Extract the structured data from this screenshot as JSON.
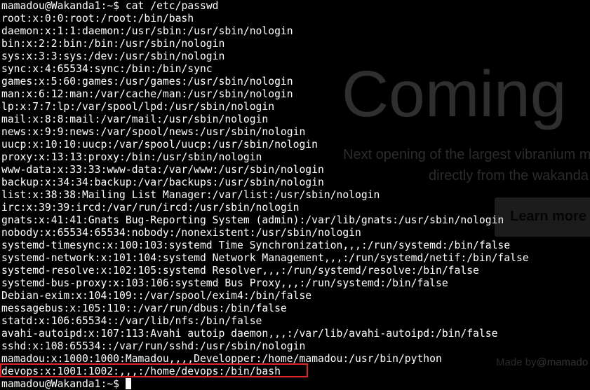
{
  "background_page": {
    "heading": "Coming",
    "tagline_line1": "Next opening of the largest vibranium m",
    "tagline_line2": "directly from the wakanda",
    "button_label": "Learn more",
    "footer_prefix": "Made by",
    "footer_author": "@mamado"
  },
  "terminal": {
    "prompt": "mamadou@Wakanda1:~$",
    "command": "cat /etc/passwd",
    "lines": [
      "root:x:0:0:root:/root:/bin/bash",
      "daemon:x:1:1:daemon:/usr/sbin:/usr/sbin/nologin",
      "bin:x:2:2:bin:/bin:/usr/sbin/nologin",
      "sys:x:3:3:sys:/dev:/usr/sbin/nologin",
      "sync:x:4:65534:sync:/bin:/bin/sync",
      "games:x:5:60:games:/usr/games:/usr/sbin/nologin",
      "man:x:6:12:man:/var/cache/man:/usr/sbin/nologin",
      "lp:x:7:7:lp:/var/spool/lpd:/usr/sbin/nologin",
      "mail:x:8:8:mail:/var/mail:/usr/sbin/nologin",
      "news:x:9:9:news:/var/spool/news:/usr/sbin/nologin",
      "uucp:x:10:10:uucp:/var/spool/uucp:/usr/sbin/nologin",
      "proxy:x:13:13:proxy:/bin:/usr/sbin/nologin",
      "www-data:x:33:33:www-data:/var/www:/usr/sbin/nologin",
      "backup:x:34:34:backup:/var/backups:/usr/sbin/nologin",
      "list:x:38:38:Mailing List Manager:/var/list:/usr/sbin/nologin",
      "irc:x:39:39:ircd:/var/run/ircd:/usr/sbin/nologin",
      "gnats:x:41:41:Gnats Bug-Reporting System (admin):/var/lib/gnats:/usr/sbin/nologin",
      "nobody:x:65534:65534:nobody:/nonexistent:/usr/sbin/nologin",
      "systemd-timesync:x:100:103:systemd Time Synchronization,,,:/run/systemd:/bin/false",
      "systemd-network:x:101:104:systemd Network Management,,,:/run/systemd/netif:/bin/false",
      "systemd-resolve:x:102:105:systemd Resolver,,,:/run/systemd/resolve:/bin/false",
      "systemd-bus-proxy:x:103:106:systemd Bus Proxy,,,:/run/systemd:/bin/false",
      "Debian-exim:x:104:109::/var/spool/exim4:/bin/false",
      "messagebus:x:105:110::/var/run/dbus:/bin/false",
      "statd:x:106:65534::/var/lib/nfs:/bin/false",
      "avahi-autoipd:x:107:113:Avahi autoip daemon,,,:/var/lib/avahi-autoipd:/bin/false",
      "sshd:x:108:65534::/var/run/sshd:/usr/sbin/nologin",
      "mamadou:x:1000:1000:Mamadou,,,,Developper:/home/mamadou:/usr/bin/python",
      "devops:x:1001:1002:,,,:/home/devops:/bin/bash"
    ],
    "highlight_color": "#e0242a"
  }
}
